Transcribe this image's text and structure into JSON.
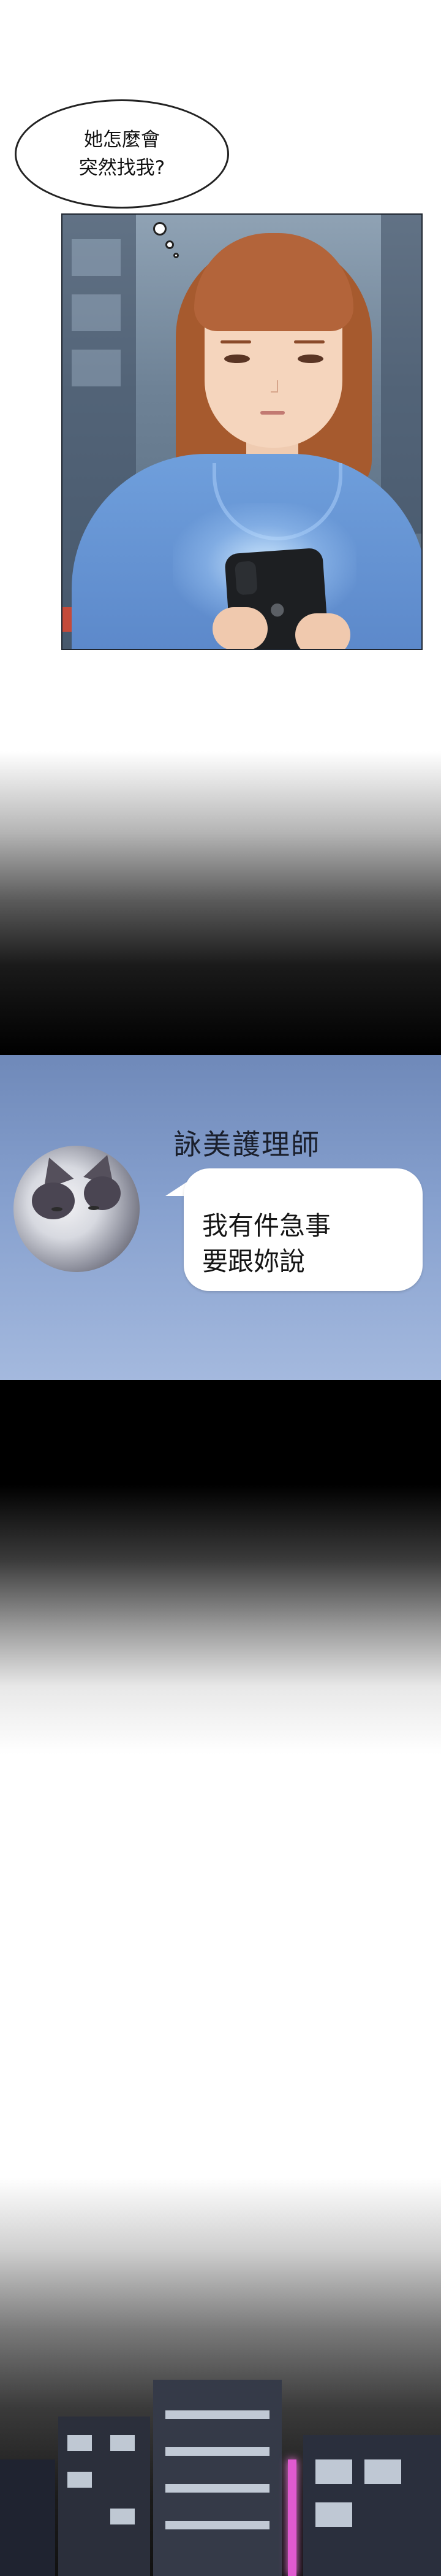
{
  "panel1": {
    "thought_bubble": {
      "text": "她怎麼會\n突然找我?"
    }
  },
  "panel2": {
    "chat": {
      "sender_name": "詠美護理師",
      "message": "我有件急事\n要跟妳說"
    }
  },
  "colors": {
    "page_background": "#ffffff",
    "chat_panel": "#86a0ce",
    "shirt": "#6f9fdc",
    "hair": "#b3643a"
  }
}
